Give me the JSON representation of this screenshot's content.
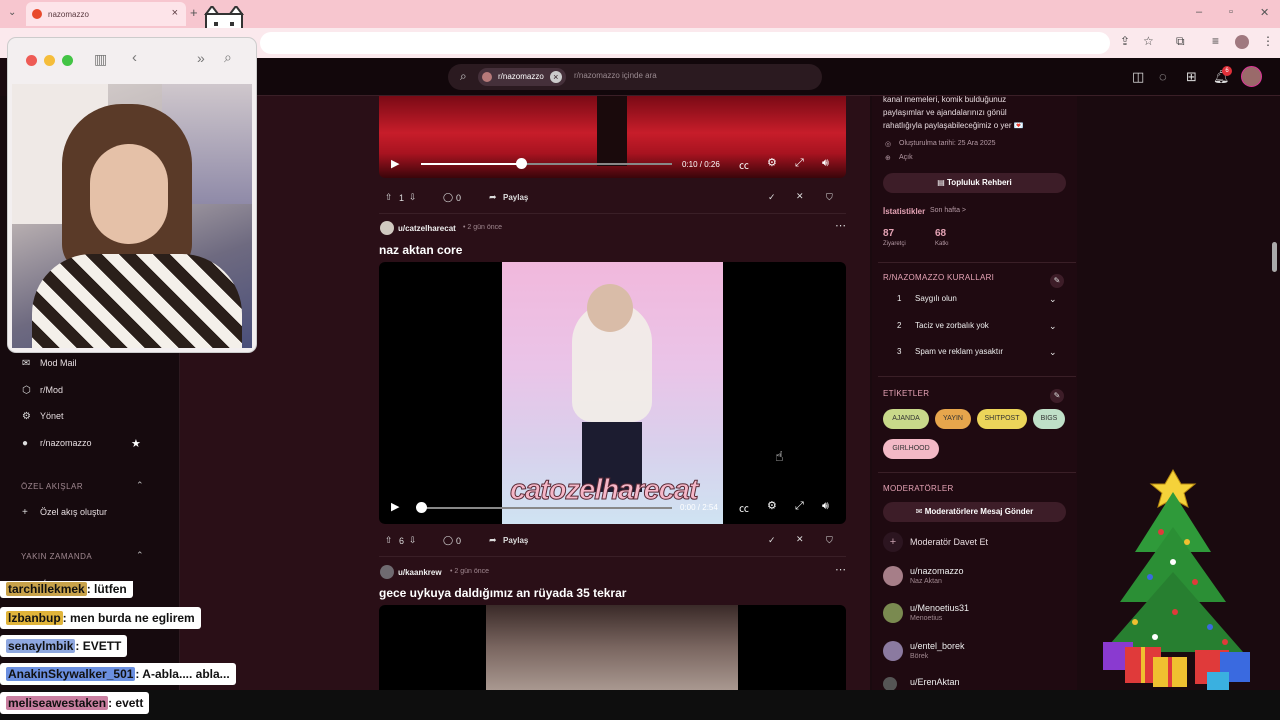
{
  "browser": {
    "tab_title": "nazomazzo",
    "tab_close": "×",
    "new_tab": "+"
  },
  "reddit": {
    "search_chip": "r/nazomazzo",
    "search_placeholder": "r/nazomazzo içinde ara",
    "notification_count": "6"
  },
  "left_sidebar": {
    "items": [
      {
        "label": "Mod Mail",
        "icon": "mail-icon"
      },
      {
        "label": "r/Mod",
        "icon": "mod-icon"
      },
      {
        "label": "Yönet",
        "icon": "gear-icon"
      },
      {
        "label": "r/nazomazzo",
        "icon": "avatar"
      }
    ],
    "section_custom_feeds": "ÖZEL AKIŞLAR",
    "create_feed": "Özel akış oluştur",
    "section_recent": "YAKIN ZAMANDA",
    "recent_item": "r/nazomazzo"
  },
  "posts": [
    {
      "video_time": "0:10 / 0:26",
      "progress": 0.4,
      "votes": "1",
      "comments": "0",
      "share": "Paylaş"
    },
    {
      "user": "u/catzelharecat",
      "age": "• 2 gün önce",
      "title": "naz aktan core",
      "watermark": "catozelharecat",
      "video_time": "0:00 / 2:54",
      "progress": 0.0,
      "votes": "6",
      "comments": "0",
      "share": "Paylaş"
    },
    {
      "user": "u/kaankrew",
      "age": "• 2 gün önce",
      "title": "gece uykuya daldığımız an rüyada 35 tekrar"
    }
  ],
  "right_sidebar": {
    "desc_line1": "kanal memeleri, komik bulduğunuz",
    "desc_line2": "paylaşımlar ve ajandalarınızı gönül",
    "desc_line3": "rahatlığıyla paylaşabileceğimiz o yer 💌",
    "created": "Oluşturulma tarihi: 25 Ara 2025",
    "open": "Açık",
    "guide_button": "Topluluk Rehberi",
    "stats_label": "İstatistikler",
    "stats_period": "Son hafta >",
    "stat1_value": "87",
    "stat1_label": "Ziyaretçi",
    "stat2_value": "68",
    "stat2_label": "Katkı",
    "rules_title": "R/NAZOMAZZO KURALLARI",
    "rules": [
      {
        "n": "1",
        "t": "Saygılı olun"
      },
      {
        "n": "2",
        "t": "Taciz ve zorbalık yok"
      },
      {
        "n": "3",
        "t": "Spam ve reklam yasaktır"
      }
    ],
    "tags_title": "ETİKETLER",
    "tags": [
      {
        "label": "AJANDA",
        "color": "#c9d98a"
      },
      {
        "label": "YAYIN",
        "color": "#e7a64c"
      },
      {
        "label": "SHITPOST",
        "color": "#ecd55a"
      },
      {
        "label": "BIGS",
        "color": "#bfe0c8"
      },
      {
        "label": "GIRLHOOD",
        "color": "#f3b9c6"
      }
    ],
    "mods_title": "MODERATÖRLER",
    "message_mods": "Moderatörlere Mesaj Gönder",
    "invite_mod": "Moderatör Davet Et",
    "mods": [
      {
        "name": "u/nazomazzo",
        "sub": "Naz Aktan"
      },
      {
        "name": "u/Menoetius31",
        "sub": "Menoetius"
      },
      {
        "name": "u/entel_borek",
        "sub": "Börek"
      },
      {
        "name": "u/ErenAktan",
        "sub": ""
      }
    ]
  },
  "chat": [
    {
      "user": "tarchillekmek",
      "msg": ": lütfen",
      "color": "#c8a24a"
    },
    {
      "user": "lzbanbup",
      "msg": ": men burda ne eglirem",
      "color": "#e0b43a"
    },
    {
      "user": "senaylmbik",
      "msg": ": EVETT",
      "color": "#8fa8e0"
    },
    {
      "user": "AnakinSkywalker_501",
      "msg": ": A-abla.... abla...",
      "color": "#6b8fe0"
    },
    {
      "user": "meliseawestaken",
      "msg": ": evett",
      "color": "#c97fa0"
    }
  ]
}
